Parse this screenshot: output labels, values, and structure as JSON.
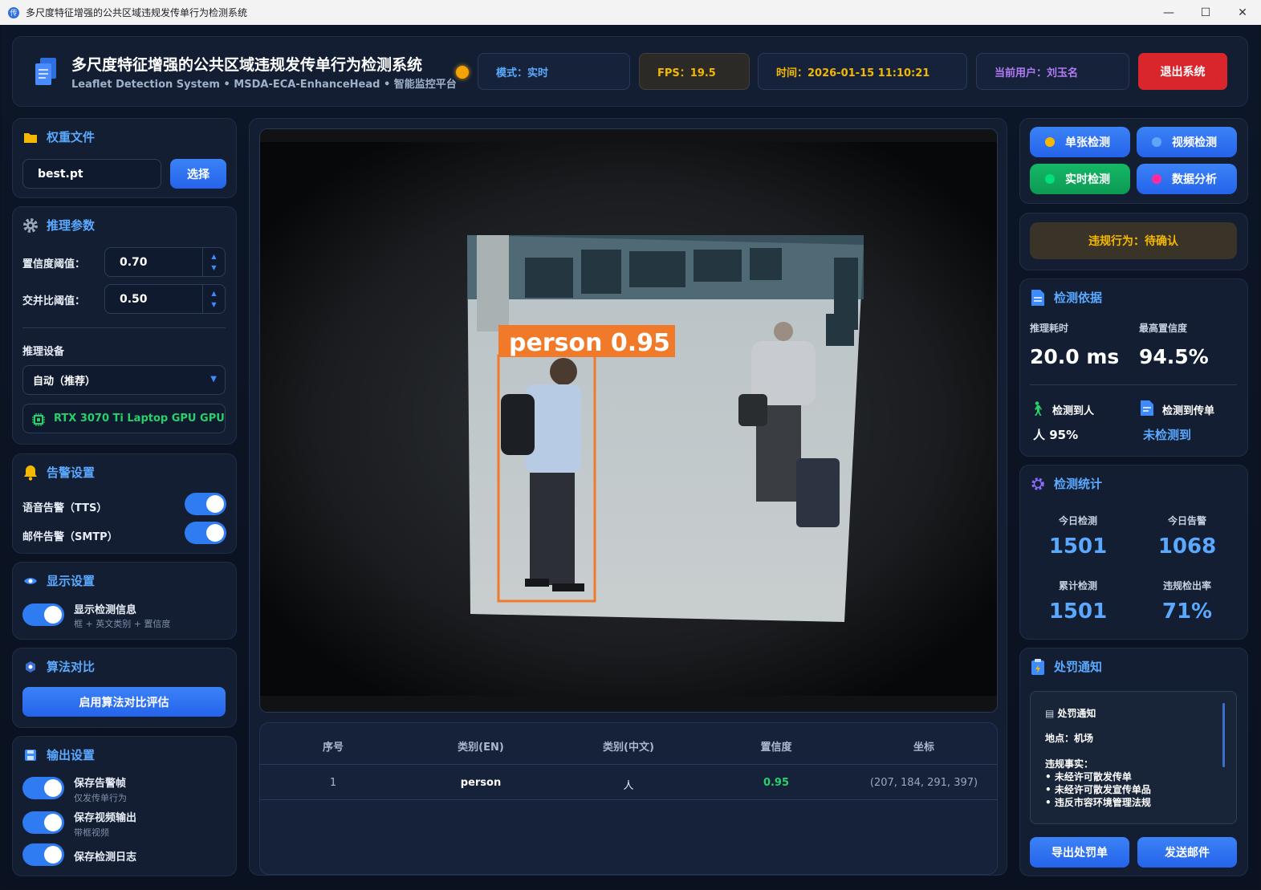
{
  "window": {
    "title": "多尺度特征增强的公共区域违规发传单行为检测系统",
    "icon_text": "传",
    "min": "—",
    "max": "☐",
    "close": "✕"
  },
  "header": {
    "title": "多尺度特征增强的公共区域违规发传单行为检测系统",
    "subtitle": "Leaflet Detection System • MSDA-ECA-EnhanceHead • 智能监控平台",
    "mode": "模式：实时",
    "fps": "FPS：19.5",
    "time": "时间：2026-01-15 11:10:21",
    "user": "当前用户：刘玉名",
    "exit_label": "退出系统",
    "status_color": "#f5a300"
  },
  "weights": {
    "title": "权重文件",
    "file": "best.pt",
    "select_label": "选择"
  },
  "inference": {
    "title": "推理参数",
    "conf_label": "置信度阈值：",
    "conf_value": "0.70",
    "iou_label": "交并比阈值：",
    "iou_value": "0.50",
    "device_label": "推理设备",
    "device_value": "自动（推荐）",
    "gpu": "RTX 3070 Ti Laptop GPU GPU"
  },
  "alarm": {
    "title": "告警设置",
    "tts_label": "语音告警（TTS）",
    "tts_on": true,
    "mail_label": "邮件告警（SMTP）",
    "mail_on": true
  },
  "display": {
    "title": "显示设置",
    "show_label": "显示检测信息",
    "show_sub": "框 + 英文类别 + 置信度",
    "show_on": true
  },
  "compare": {
    "title": "算法对比",
    "button": "启用算法对比评估"
  },
  "output": {
    "title": "输出设置",
    "items": [
      {
        "label": "保存告警帧",
        "sub": "仅发传单行为",
        "on": true
      },
      {
        "label": "保存视频输出",
        "sub": "带框视频",
        "on": true
      },
      {
        "label": "保存检测日志",
        "sub": "",
        "on": true
      }
    ]
  },
  "detection_box": {
    "label": "person 0.95",
    "color": "#f07a2a"
  },
  "table": {
    "headers": [
      "序号",
      "类别(EN)",
      "类别(中文)",
      "置信度",
      "坐标"
    ],
    "rows": [
      [
        "1",
        "person",
        "人",
        "0.95",
        "(207, 184, 291, 397)"
      ]
    ]
  },
  "modes": [
    {
      "label": "单张检测",
      "dot": "#f5b800"
    },
    {
      "label": "视频检测",
      "dot": "#60a5fa"
    },
    {
      "label": "实时检测",
      "dot": "#00c26e"
    },
    {
      "label": "数据分析",
      "dot": "#ff2ba0"
    }
  ],
  "violation": {
    "label": "违规行为：待确认"
  },
  "basis": {
    "title": "检测依据",
    "time_label": "推理耗时",
    "time_value": "20.0 ms",
    "conf_label": "最高置信度",
    "conf_value": "94.5%",
    "person_label": "检测到人",
    "person_value": "人 95%",
    "leaflet_label": "检测到传单",
    "leaflet_value": "未检测到"
  },
  "stats": {
    "title": "检测统计",
    "items": [
      {
        "label": "今日检测",
        "value": "1501"
      },
      {
        "label": "今日告警",
        "value": "1068"
      },
      {
        "label": "累计检测",
        "value": "1501"
      },
      {
        "label": "违规检出率",
        "value": "71%"
      }
    ]
  },
  "penalty": {
    "title": "处罚通知",
    "note_title": "处罚通知",
    "location": "地点：机场",
    "facts_title": "违规事实：",
    "facts": [
      "• 未经许可散发传单",
      "• 未经许可散发宣传单品",
      "• 违反市容环境管理法规"
    ],
    "export_label": "导出处罚单",
    "mail_label": "发送邮件"
  }
}
